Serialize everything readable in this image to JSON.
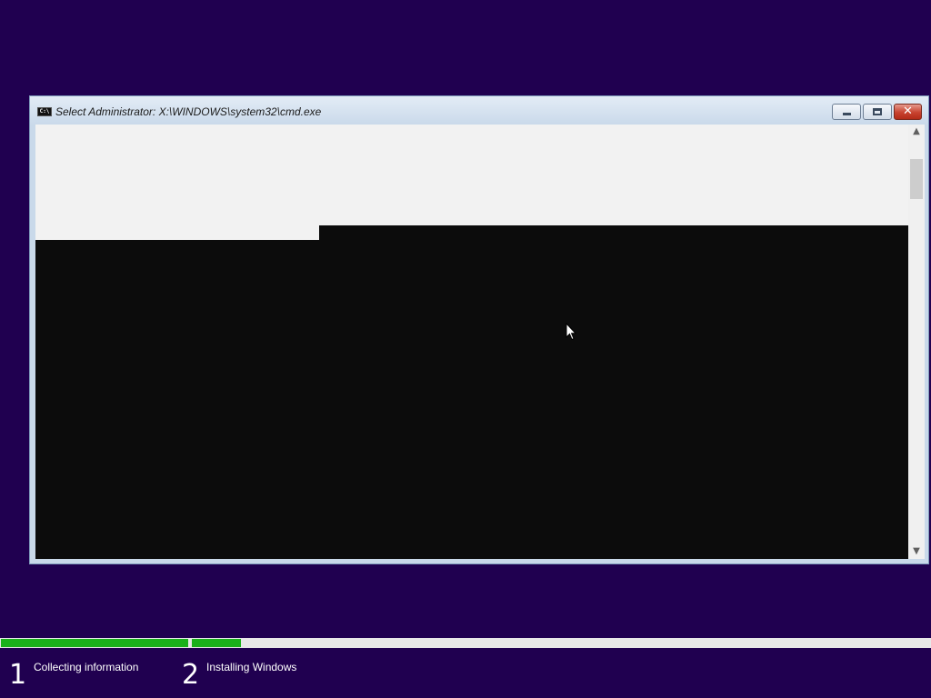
{
  "window": {
    "title": "Select Administrator: X:\\WINDOWS\\system32\\cmd.exe",
    "icon": "console-icon",
    "buttons": [
      "minimize-icon",
      "maximize-icon",
      "close-icon"
    ],
    "close_glyph": "✕"
  },
  "console": {
    "background_color": "#0c0c0c",
    "highlight_color": "#f2f2f2"
  },
  "setup": {
    "background_color": "#200050",
    "steps": [
      {
        "number": "1",
        "label": "Collecting information",
        "progress": 1.0
      },
      {
        "number": "2",
        "label": "Installing Windows",
        "progress": 0.066
      }
    ],
    "progress_color": "#1ab11a"
  }
}
